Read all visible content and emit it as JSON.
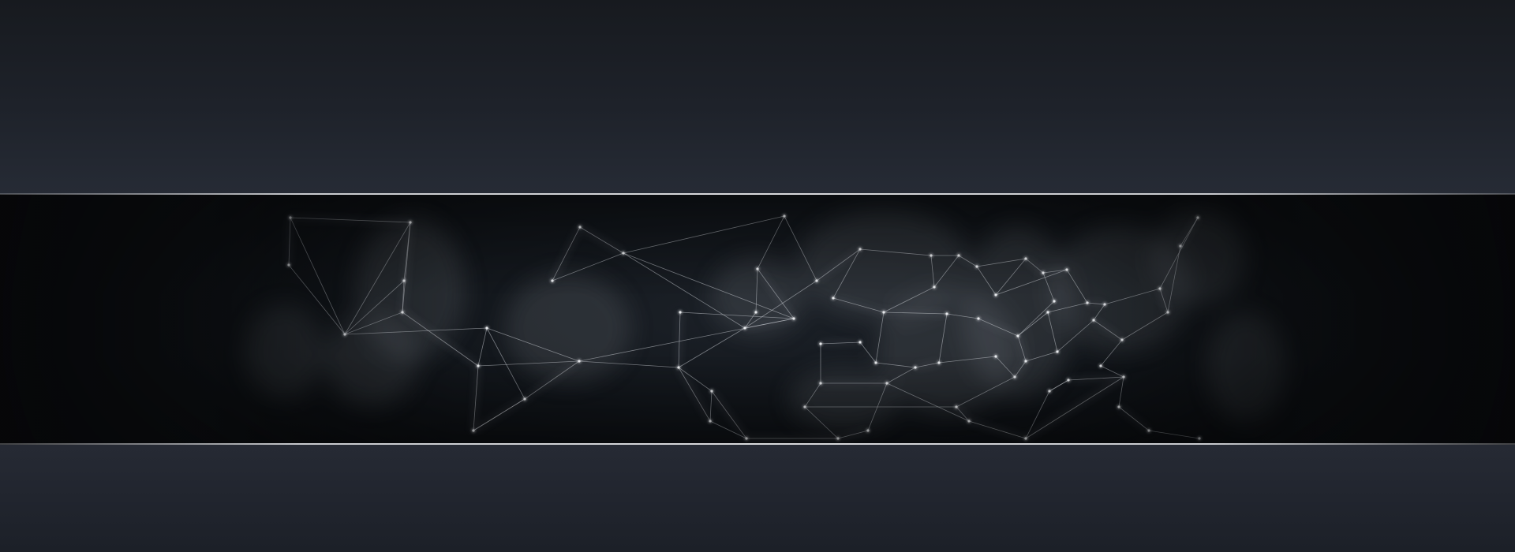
{
  "page": {
    "background_color": "#1b1f26",
    "banner_background_color": "#0e1115",
    "edge_line_color": "#d0d1d4",
    "network_line_color": "#c8ccd2",
    "network_node_color": "#e9ebee",
    "haze_color": "#8a9098"
  },
  "artwork": {
    "name": "plexus-network-icon",
    "description_hidden": true
  }
}
